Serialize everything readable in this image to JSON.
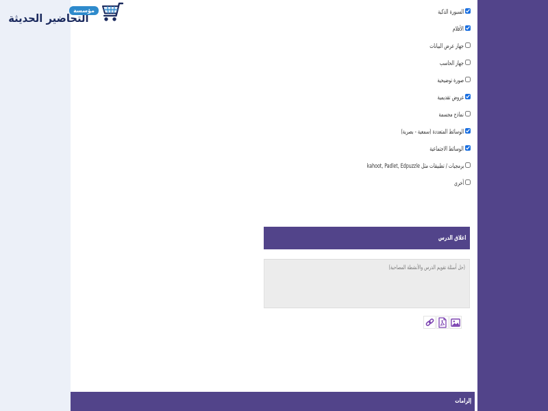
{
  "logo": {
    "badge": "مؤسسة",
    "name": "التحاضير الحديثة",
    "icon": "shopping-cart-icon"
  },
  "materials": {
    "items": [
      {
        "label": "السبورة الذكية",
        "checked": true
      },
      {
        "label": "الأقلام",
        "checked": true
      },
      {
        "label": "جهاز عرض البيانات",
        "checked": false
      },
      {
        "label": "جهاز الحاسب",
        "checked": false
      },
      {
        "label": "صورة توضيحية",
        "checked": false
      },
      {
        "label": "عروض تقديمية",
        "checked": true
      },
      {
        "label": "نماذج مجسمة",
        "checked": false
      },
      {
        "label": "الوسائط المتعددة (سمعية - بصرية)",
        "checked": true
      },
      {
        "label": "الوسائط الاجتماعية",
        "checked": true
      },
      {
        "label": "برمجيات / تطبيقات مثل kahoot, Padlet, Edpuzzle",
        "checked": false
      },
      {
        "label": "أخرى",
        "checked": false
      }
    ]
  },
  "lesson_closing": {
    "title": "اغلاق الدرس",
    "placeholder": "(حل أسئلة تقويم الدرس والأنشطة المصاحبة)",
    "value": ""
  },
  "attachments": {
    "buttons": [
      {
        "icon": "link-icon"
      },
      {
        "icon": "pdf-file-icon"
      },
      {
        "icon": "image-icon"
      }
    ]
  },
  "obligations": {
    "title": "إلزامات"
  },
  "colors": {
    "section_purple": "#52448a",
    "checkbox_blue": "#1a6fe0",
    "logo_navy": "#1b2a5e",
    "logo_badge_blue": "#2f8bcc",
    "icon_purple": "#7b42b0",
    "page_background": "#ecf0f8",
    "textarea_background": "#ececec"
  }
}
